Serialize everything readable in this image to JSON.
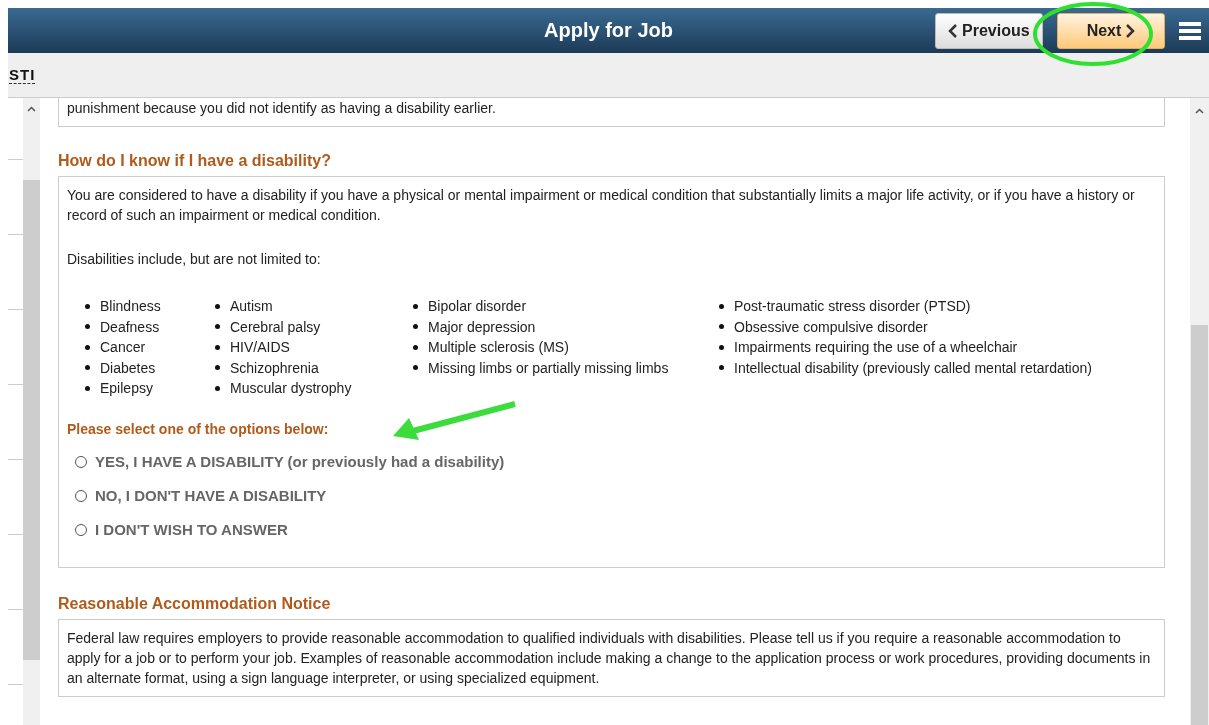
{
  "header": {
    "title": "Apply for Job",
    "buttons": [
      {
        "label": "Previous",
        "kind": "previous"
      },
      {
        "label": "Next",
        "kind": "next"
      }
    ]
  },
  "subheader": {
    "text": "STI"
  },
  "intro_box": {
    "text": "punishment because you did not identify as having a disability earlier."
  },
  "disability_section": {
    "heading": "How do I know if I have a disability?",
    "paragraphs": [
      "You are considered to have a disability if you have a physical or mental impairment or medical condition that substantially limits a major life activity, or if you have a history or record of such an impairment or medical condition.",
      "Disabilities include, but are not limited to:"
    ],
    "list_columns": [
      [
        "Blindness",
        "Deafness",
        "Cancer",
        "Diabetes",
        "Epilepsy"
      ],
      [
        "Autism",
        "Cerebral palsy",
        "HIV/AIDS",
        "Schizophrenia",
        "Muscular dystrophy"
      ],
      [
        "Bipolar disorder",
        "Major depression",
        "Multiple sclerosis (MS)",
        "Missing limbs or partially missing limbs"
      ],
      [
        "Post-traumatic stress disorder (PTSD)",
        "Obsessive compulsive disorder",
        "Impairments requiring the use of a wheelchair",
        "Intellectual disability (previously called mental retardation)"
      ]
    ],
    "prompt": "Please select one of the options below:",
    "options": [
      {
        "label": "YES, I HAVE A DISABILITY (or previously had a disability)",
        "selected": false
      },
      {
        "label": "NO, I DON'T HAVE A DISABILITY",
        "selected": false
      },
      {
        "label": "I DON'T WISH TO ANSWER",
        "selected": false
      }
    ]
  },
  "accommodation_section": {
    "heading": "Reasonable Accommodation Notice",
    "text": "Federal law requires employers to provide reasonable accommodation to qualified individuals with disabilities. Please tell us if you require a reasonable accommodation to apply for a job or to perform your job. Examples of reasonable accommodation include making a change to the application process or work procedures, providing documents in an alternate format, using a sign language interpreter, or using specialized equipment."
  }
}
